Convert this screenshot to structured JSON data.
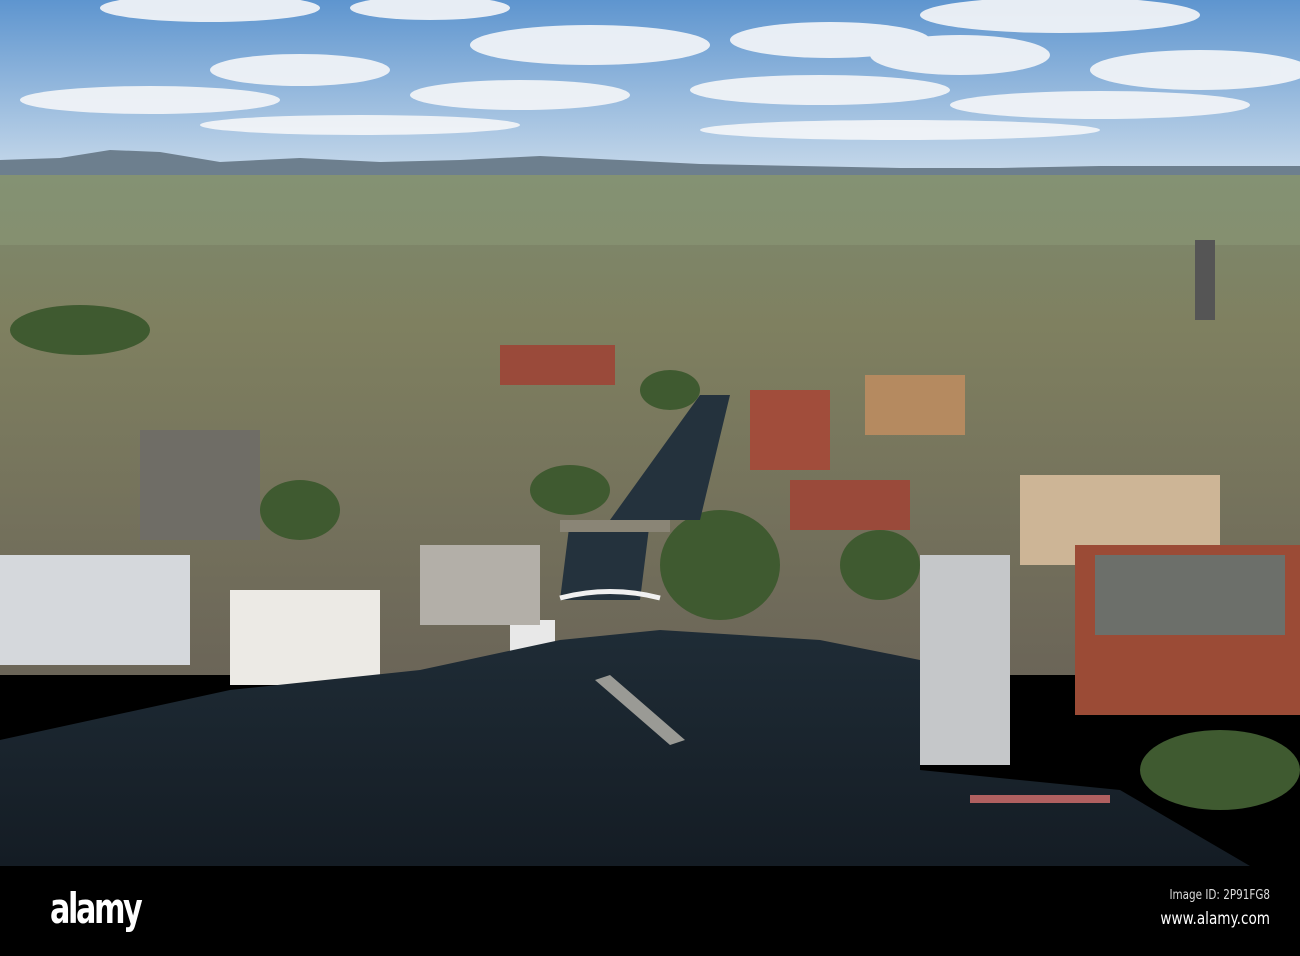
{
  "photo": {
    "subject": "aerial-city-river",
    "colors": {
      "sky": "#8fb8e0",
      "water": "#1a2430",
      "land": "#6f7a5a",
      "brick": "#9a4a3a"
    }
  },
  "watermark": {
    "logo": "alamy",
    "image_id": "Image ID: 2P91FG8",
    "site": "www.alamy.com"
  }
}
